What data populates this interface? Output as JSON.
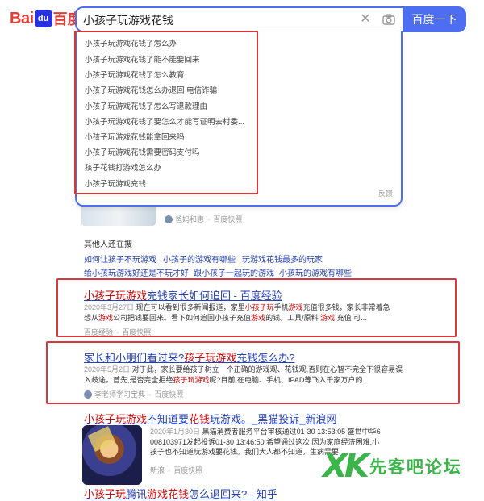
{
  "header": {
    "logo_text_latin": "Bai",
    "logo_paw": "du",
    "logo_text_cn": "百度",
    "search_value": "小孩子玩游戏花钱",
    "search_button": "百度一下"
  },
  "suggestions": [
    "小孩子玩游戏花钱了怎么办",
    "小孩子玩游戏花钱了能不能要回来",
    "小孩子玩游戏花钱了怎么教育",
    "小孩子玩游戏花钱怎么办退回 电信诈骗",
    "小孩子玩游戏花钱了怎么写退款理由",
    "小孩子玩游戏花钱了要怎么才能写证明去村委...",
    "小孩子玩游戏花钱能拿回来吗",
    "小孩子玩游戏花钱需要密码支付吗",
    "孩子花钱打游戏怎么办",
    "小孩子玩游戏充钱"
  ],
  "suggest_feedback": "反馈",
  "result0": {
    "source": "爸妈和惠",
    "tag": "百度快照"
  },
  "others": {
    "title": "其他人还在搜",
    "items": [
      "如何让孩子不玩游戏",
      "小孩子的游戏有哪些",
      "玩游戏花钱最多的玩家",
      "给小孩玩游戏好还是不玩才好",
      "跟小孩子一起玩的游戏",
      "小孩玩的游戏有哪些"
    ]
  },
  "result1": {
    "title_em": "小孩子玩游戏",
    "title_rest": "充钱家长如何追回 - 百度经验",
    "date": "2020年3月27日",
    "line1_a": "现在可以看到很多新闻报道，家里",
    "line1_em1": "小孩子玩",
    "line1_b": "手机",
    "line1_em2": "游戏",
    "line1_c": "充值很多钱，家长非常着急",
    "line2_a": "想从",
    "line2_em1": "游戏",
    "line2_b": "公司把钱要回来。看下如何追回小孩子充值",
    "line2_em2": "游戏",
    "line2_c": "的钱。工具/原料",
    "line2_em3": "游戏",
    "line2_d": "充值 可...",
    "source": "百度经验",
    "tag": "百度快照"
  },
  "result2": {
    "title_a": "家长和小朋们看过来?",
    "title_em": "孩子玩游戏",
    "title_b": "充钱怎么办?",
    "date": "2020年5月2日",
    "line1": "对于此，家长要给孩子树立一个正确的游戏观、花钱观,否则在心智不完全下很容易误",
    "line2_a": "入歧途。首先,是否完全拒绝",
    "line2_em": "孩子玩游戏",
    "line2_b": "呢?目前,在电脑、手机、IPAD等飞入千家万户的...",
    "source": "李老师学习宝典",
    "tag": "百度快照"
  },
  "result3": {
    "title_em1": "小孩子玩游戏",
    "title_a": "不知道要",
    "title_em2": "花钱",
    "title_b": "玩游戏。_黑猫投诉_新浪网",
    "date": "2020年1月30日",
    "line1": "黑猫消费者服务平台审核通过01-30 13:53:05 盛世中华6",
    "line2": "008103971发起投诉01-30 13:46:50 希望通过这次 因为家庭经济困难,小",
    "line3": "孩子也不知道玩游戏要花钱。我们大人都不知道，生病需要",
    "source": "新浪",
    "tag": "百度快照"
  },
  "result4": {
    "title_em1": "小孩子玩",
    "title_a": "腾讯",
    "title_em2": "游戏花钱",
    "title_b": "怎么退回来? - 知乎"
  },
  "watermark": {
    "mark": "XK",
    "text": "先客吧论坛"
  },
  "colors": {
    "accent": "#4e6ef2",
    "link": "#2440b3",
    "highlight": "#c00000",
    "frame": "#d9363e",
    "watermark": "#3bb54a"
  }
}
